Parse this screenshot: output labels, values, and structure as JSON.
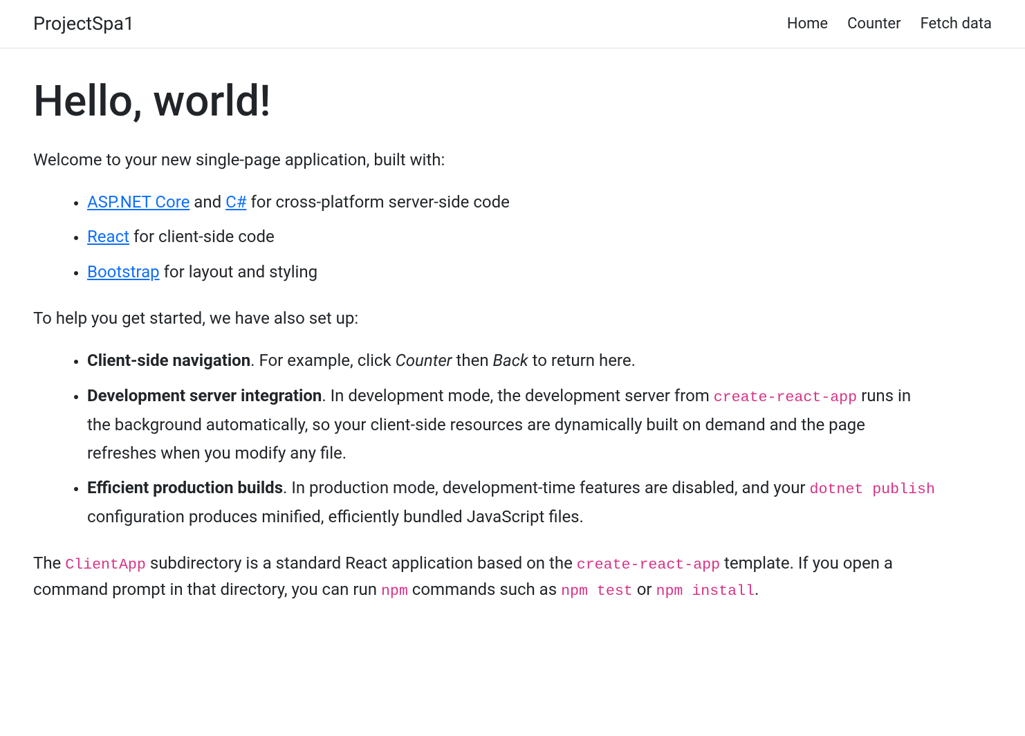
{
  "navbar": {
    "brand": "ProjectSpa1",
    "items": [
      {
        "label": "Home"
      },
      {
        "label": "Counter"
      },
      {
        "label": "Fetch data"
      }
    ]
  },
  "main": {
    "heading": "Hello, world!",
    "intro": "Welcome to your new single-page application, built with:",
    "techList": [
      {
        "link1": "ASP.NET Core",
        "text1": " and ",
        "link2": "C#",
        "text2": " for cross-platform server-side code"
      },
      {
        "link1": "React",
        "text1": " for client-side code"
      },
      {
        "link1": "Bootstrap",
        "text1": " for layout and styling"
      }
    ],
    "setupIntro": "To help you get started, we have also set up:",
    "featureList": [
      {
        "bold": "Client-side navigation",
        "text1": ". For example, click ",
        "em1": "Counter",
        "text2": " then ",
        "em2": "Back",
        "text3": " to return here."
      },
      {
        "bold": "Development server integration",
        "text1": ". In development mode, the development server from ",
        "code1": "create-react-app",
        "text2": " runs in the background automatically, so your client-side resources are dynamically built on demand and the page refreshes when you modify any file."
      },
      {
        "bold": "Efficient production builds",
        "text1": ". In production mode, development-time features are disabled, and your ",
        "code1": "dotnet publish",
        "text2": " configuration produces minified, efficiently bundled JavaScript files."
      }
    ],
    "finalPara": {
      "text1": "The ",
      "code1": "ClientApp",
      "text2": " subdirectory is a standard React application based on the ",
      "code2": "create-react-app",
      "text3": " template. If you open a command prompt in that directory, you can run ",
      "code3": "npm",
      "text4": " commands such as ",
      "code4": "npm test",
      "text5": " or ",
      "code5": "npm install",
      "text6": "."
    }
  }
}
